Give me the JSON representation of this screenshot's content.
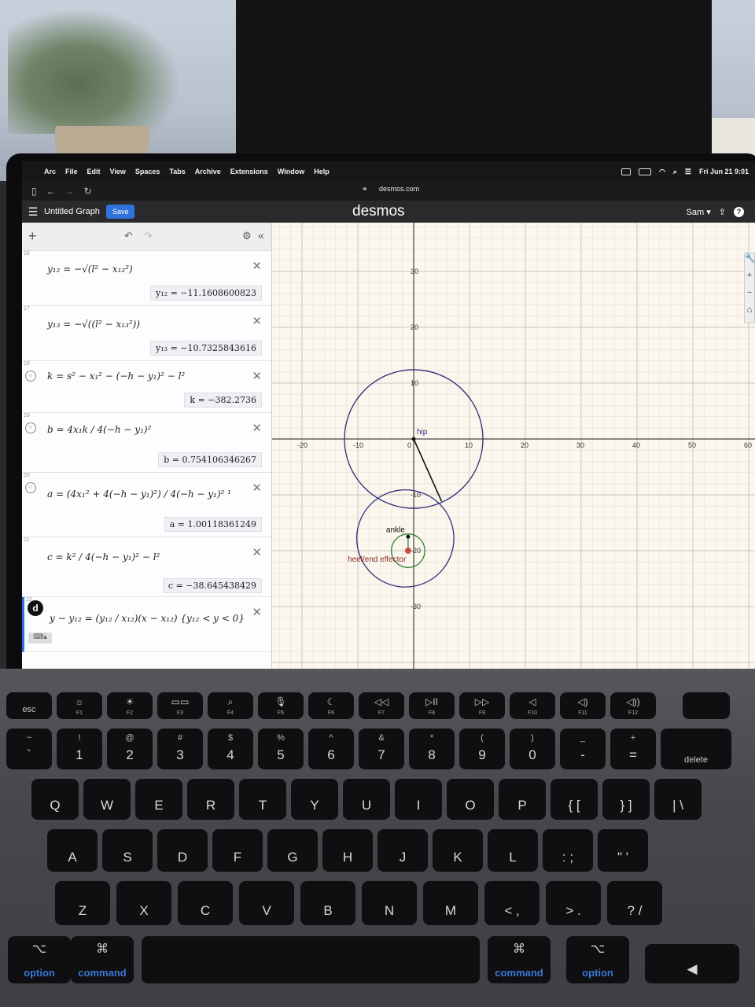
{
  "menubar": {
    "items": [
      "Arc",
      "File",
      "Edit",
      "View",
      "Spaces",
      "Tabs",
      "Archive",
      "Extensions",
      "Window",
      "Help"
    ],
    "datetime": "Fri Jun 21 9:01"
  },
  "browser": {
    "url": "desmos.com"
  },
  "app": {
    "title": "Untitled Graph",
    "save_label": "Save",
    "brand": "desmos",
    "user": "Sam ▾"
  },
  "expressions": [
    {
      "num": "16",
      "formula": "y₁₂ = −√(l² − x₁₂²)",
      "result": "y₁₂ = −11.1608600823"
    },
    {
      "num": "17",
      "formula": "y₁₃ = −√((l² − x₁₃²))",
      "result": "y₁₃ = −10.7325843616"
    },
    {
      "num": "18",
      "formula": "k = s² − x₁² − (−h − y₁)² − l²",
      "result": "k = −382.2736"
    },
    {
      "num": "19",
      "formula": "b = 4x₁k / 4(−h − y₁)²",
      "result": "b = 0.754106346267"
    },
    {
      "num": "20",
      "formula": "a = (4x₁² + 4(−h − y₁)²) / 4(−h − y₁)² ¹",
      "result": "a = 1.00118361249"
    },
    {
      "num": "21",
      "formula": "c = k² / 4(−h − y₁)² − l²",
      "result": "c = −38.645438429"
    },
    {
      "num": "22",
      "formula": "y − y₁₂ = (y₁₂ / x₁₂)(x − x₁₂) {y₁₂ < y < 0}",
      "result": ""
    }
  ],
  "graph": {
    "x_ticks": [
      "-20",
      "-10",
      "0",
      "10",
      "20",
      "30",
      "40",
      "50",
      "60"
    ],
    "y_ticks": [
      "30",
      "20",
      "10",
      "-10",
      "-20",
      "-30"
    ],
    "labels": {
      "hip": "hip",
      "ankle": "ankle",
      "heel": "heel/end effector"
    },
    "colors": {
      "circle": "#2d2f7a",
      "inner_circle": "#2e7d32",
      "effector": "#c0392b",
      "leg": "#111111"
    }
  },
  "keyboard": {
    "fn_row": [
      {
        "icon": "",
        "label": "esc"
      },
      {
        "icon": "☼",
        "label": "F1"
      },
      {
        "icon": "☀",
        "label": "F2"
      },
      {
        "icon": "▭▭",
        "label": "F3"
      },
      {
        "icon": "⌕",
        "label": "F4"
      },
      {
        "icon": "🎙",
        "label": "F5"
      },
      {
        "icon": "☾",
        "label": "F6"
      },
      {
        "icon": "◁◁",
        "label": "F7"
      },
      {
        "icon": "▷II",
        "label": "F8"
      },
      {
        "icon": "▷▷",
        "label": "F9"
      },
      {
        "icon": "◁",
        "label": "F10"
      },
      {
        "icon": "◁)",
        "label": "F11"
      },
      {
        "icon": "◁))",
        "label": "F12"
      }
    ],
    "num_row": [
      {
        "top": "~",
        "main": "`"
      },
      {
        "top": "!",
        "main": "1"
      },
      {
        "top": "@",
        "main": "2"
      },
      {
        "top": "#",
        "main": "3"
      },
      {
        "top": "$",
        "main": "4"
      },
      {
        "top": "%",
        "main": "5"
      },
      {
        "top": "^",
        "main": "6"
      },
      {
        "top": "&",
        "main": "7"
      },
      {
        "top": "*",
        "main": "8"
      },
      {
        "top": "(",
        "main": "9"
      },
      {
        "top": ")",
        "main": "0"
      },
      {
        "top": "_",
        "main": "-"
      },
      {
        "top": "+",
        "main": "="
      },
      {
        "top": "",
        "main": "delete"
      }
    ],
    "row_q": [
      "Q",
      "W",
      "E",
      "R",
      "T",
      "Y",
      "U",
      "I",
      "O",
      "P",
      "{ [",
      "} ]",
      "| \\"
    ],
    "row_a": [
      "A",
      "S",
      "D",
      "F",
      "G",
      "H",
      "J",
      "K",
      "L",
      ": ;",
      "\" '"
    ],
    "row_z": [
      "Z",
      "X",
      "C",
      "V",
      "B",
      "N",
      "M",
      "< ,",
      "> .",
      "? /"
    ],
    "bottom": [
      {
        "sym": "⌥",
        "label": "option"
      },
      {
        "sym": "⌘",
        "label": "command"
      },
      {
        "sym": "⌘",
        "label": "command"
      },
      {
        "sym": "⌥",
        "label": "option"
      }
    ]
  }
}
